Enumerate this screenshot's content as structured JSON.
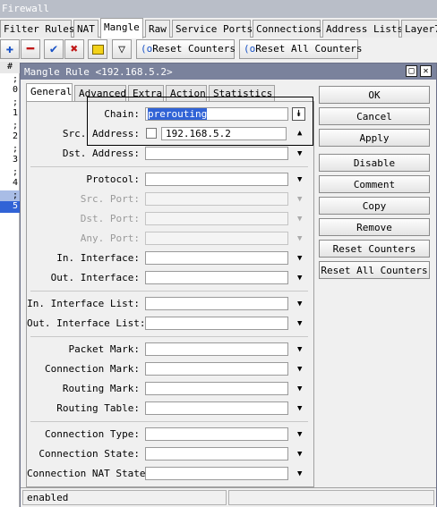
{
  "firewall": {
    "title": "Firewall",
    "tabs": [
      "Filter Rules",
      "NAT",
      "Mangle",
      "Raw",
      "Service Ports",
      "Connections",
      "Address Lists",
      "Layer7"
    ],
    "active_tab": "Mangle",
    "toolbar": {
      "reset_counters": "Reset Counters",
      "reset_all_counters": "Reset All Counters"
    },
    "list_header": "#",
    "rows": [
      ";;",
      "0",
      ";;",
      "1",
      ";;",
      "2",
      ";;",
      "3",
      ";;",
      "4",
      ";;",
      "5"
    ]
  },
  "dialog": {
    "title": "Mangle Rule <192.168.5.2>",
    "tabs": [
      "General",
      "Advanced",
      "Extra",
      "Action",
      "Statistics"
    ],
    "active_tab": "General",
    "fields": {
      "chain": {
        "label": "Chain:",
        "value": "prerouting"
      },
      "src_address": {
        "label": "Src. Address:",
        "value": "192.168.5.2"
      },
      "dst_address": {
        "label": "Dst. Address:"
      },
      "protocol": {
        "label": "Protocol:"
      },
      "src_port": {
        "label": "Src. Port:"
      },
      "dst_port": {
        "label": "Dst. Port:"
      },
      "any_port": {
        "label": "Any. Port:"
      },
      "in_interface": {
        "label": "In. Interface:"
      },
      "out_interface": {
        "label": "Out. Interface:"
      },
      "in_interface_list": {
        "label": "In. Interface List:"
      },
      "out_interface_list": {
        "label": "Out. Interface List:"
      },
      "packet_mark": {
        "label": "Packet Mark:"
      },
      "connection_mark": {
        "label": "Connection Mark:"
      },
      "routing_mark": {
        "label": "Routing Mark:"
      },
      "routing_table": {
        "label": "Routing Table:"
      },
      "connection_type": {
        "label": "Connection Type:"
      },
      "connection_state": {
        "label": "Connection State:"
      },
      "connection_nat_state": {
        "label": "Connection NAT State:"
      }
    },
    "buttons": {
      "ok": "OK",
      "cancel": "Cancel",
      "apply": "Apply",
      "disable": "Disable",
      "comment": "Comment",
      "copy": "Copy",
      "remove": "Remove",
      "reset_counters": "Reset Counters",
      "reset_all_counters": "Reset All Counters"
    },
    "status": "enabled"
  },
  "colors": {
    "title_bar": "#7a829c",
    "selection": "#3163d6",
    "highlight_box": "#000000"
  }
}
